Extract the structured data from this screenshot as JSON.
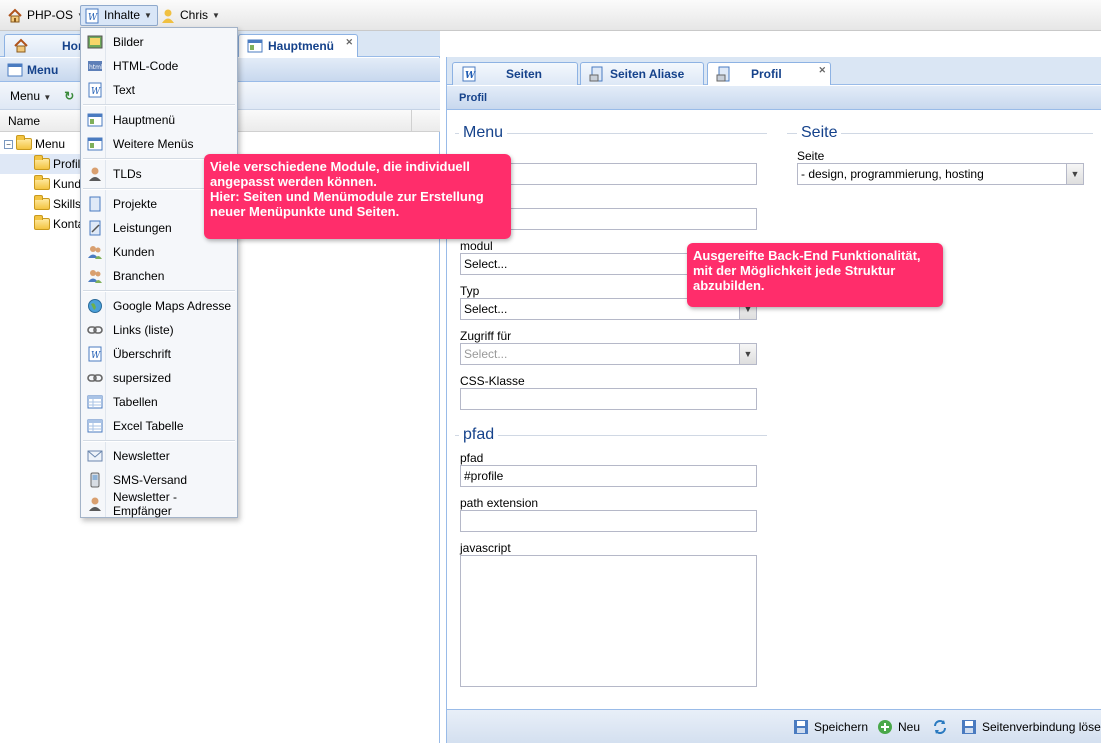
{
  "topbar": {
    "brand": "PHP-OS",
    "menu_inhalte": "Inhalte",
    "user": "Chris"
  },
  "left_tabs": {
    "home": "Home",
    "hauptmenu": "Hauptmenü"
  },
  "menu_panel": {
    "title": "Menu",
    "toolbar_menu": "Menu",
    "column_name": "Name",
    "tree": {
      "root": "Menu",
      "children": [
        "Profil",
        "Kunden",
        "Skills",
        "Kontakt"
      ]
    }
  },
  "dropdown": {
    "items": [
      {
        "label": "Bilder",
        "icon": "image-icon"
      },
      {
        "label": "HTML-Code",
        "icon": "html-icon"
      },
      {
        "label": "Text",
        "icon": "text-doc-icon"
      },
      {
        "label": "Hauptmenü",
        "icon": "menu-window-icon"
      },
      {
        "label": "Weitere Menüs",
        "icon": "menu-window-icon"
      },
      {
        "label": "TLDs",
        "icon": "person-icon"
      },
      {
        "label": "Projekte",
        "icon": "page-icon"
      },
      {
        "label": "Leistungen",
        "icon": "page-edit-icon"
      },
      {
        "label": "Kunden",
        "icon": "users-icon"
      },
      {
        "label": "Branchen",
        "icon": "users-icon"
      },
      {
        "label": "Google Maps Adresse",
        "icon": "globe-icon"
      },
      {
        "label": "Links (liste)",
        "icon": "link-icon"
      },
      {
        "label": "Überschrift",
        "icon": "text-doc-icon"
      },
      {
        "label": "supersized",
        "icon": "link-icon"
      },
      {
        "label": "Tabellen",
        "icon": "table-icon"
      },
      {
        "label": "Excel Tabelle",
        "icon": "table-icon"
      },
      {
        "label": "Newsletter",
        "icon": "mail-icon"
      },
      {
        "label": "SMS-Versand",
        "icon": "phone-icon"
      },
      {
        "label": "Newsletter - Empfänger",
        "icon": "person-icon"
      }
    ]
  },
  "right_tabs": {
    "seiten": "Seiten",
    "seiten_aliase": "Seiten Aliase",
    "profil": "Profil"
  },
  "form": {
    "header": "Profil",
    "section_menu": "Menu",
    "section_seite": "Seite",
    "section_pfad": "pfad",
    "seite_label": "Seite",
    "seite_value": "- design, programmierung, hosting",
    "modul_label": "modul",
    "modul_value": "Select...",
    "typ_label": "Typ",
    "typ_value": "Select...",
    "zugriff_label": "Zugriff für",
    "zugriff_value": "Select...",
    "css_label": "CSS-Klasse",
    "pfad_label": "pfad",
    "pfad_value": "#profile",
    "path_ext_label": "path extension",
    "javascript_label": "javascript"
  },
  "footer": {
    "save": "Speichern",
    "new": "Neu",
    "unlink": "Seitenverbindung lösen"
  },
  "callouts": {
    "modules": [
      "Viele verschiedene Module, die individuell",
      "angepasst werden können.",
      "Hier: Seiten und Menümodule zur Erstellung",
      "neuer Menüpunkte und Seiten."
    ],
    "backend": [
      "Ausgereifte Back-End Funktionalität,",
      "mit der Möglichkeit jede Struktur",
      "abzubilden."
    ]
  },
  "colors": {
    "callout": "#ff2d6b",
    "header_text": "#15428b",
    "panel_border": "#99bbe8"
  }
}
